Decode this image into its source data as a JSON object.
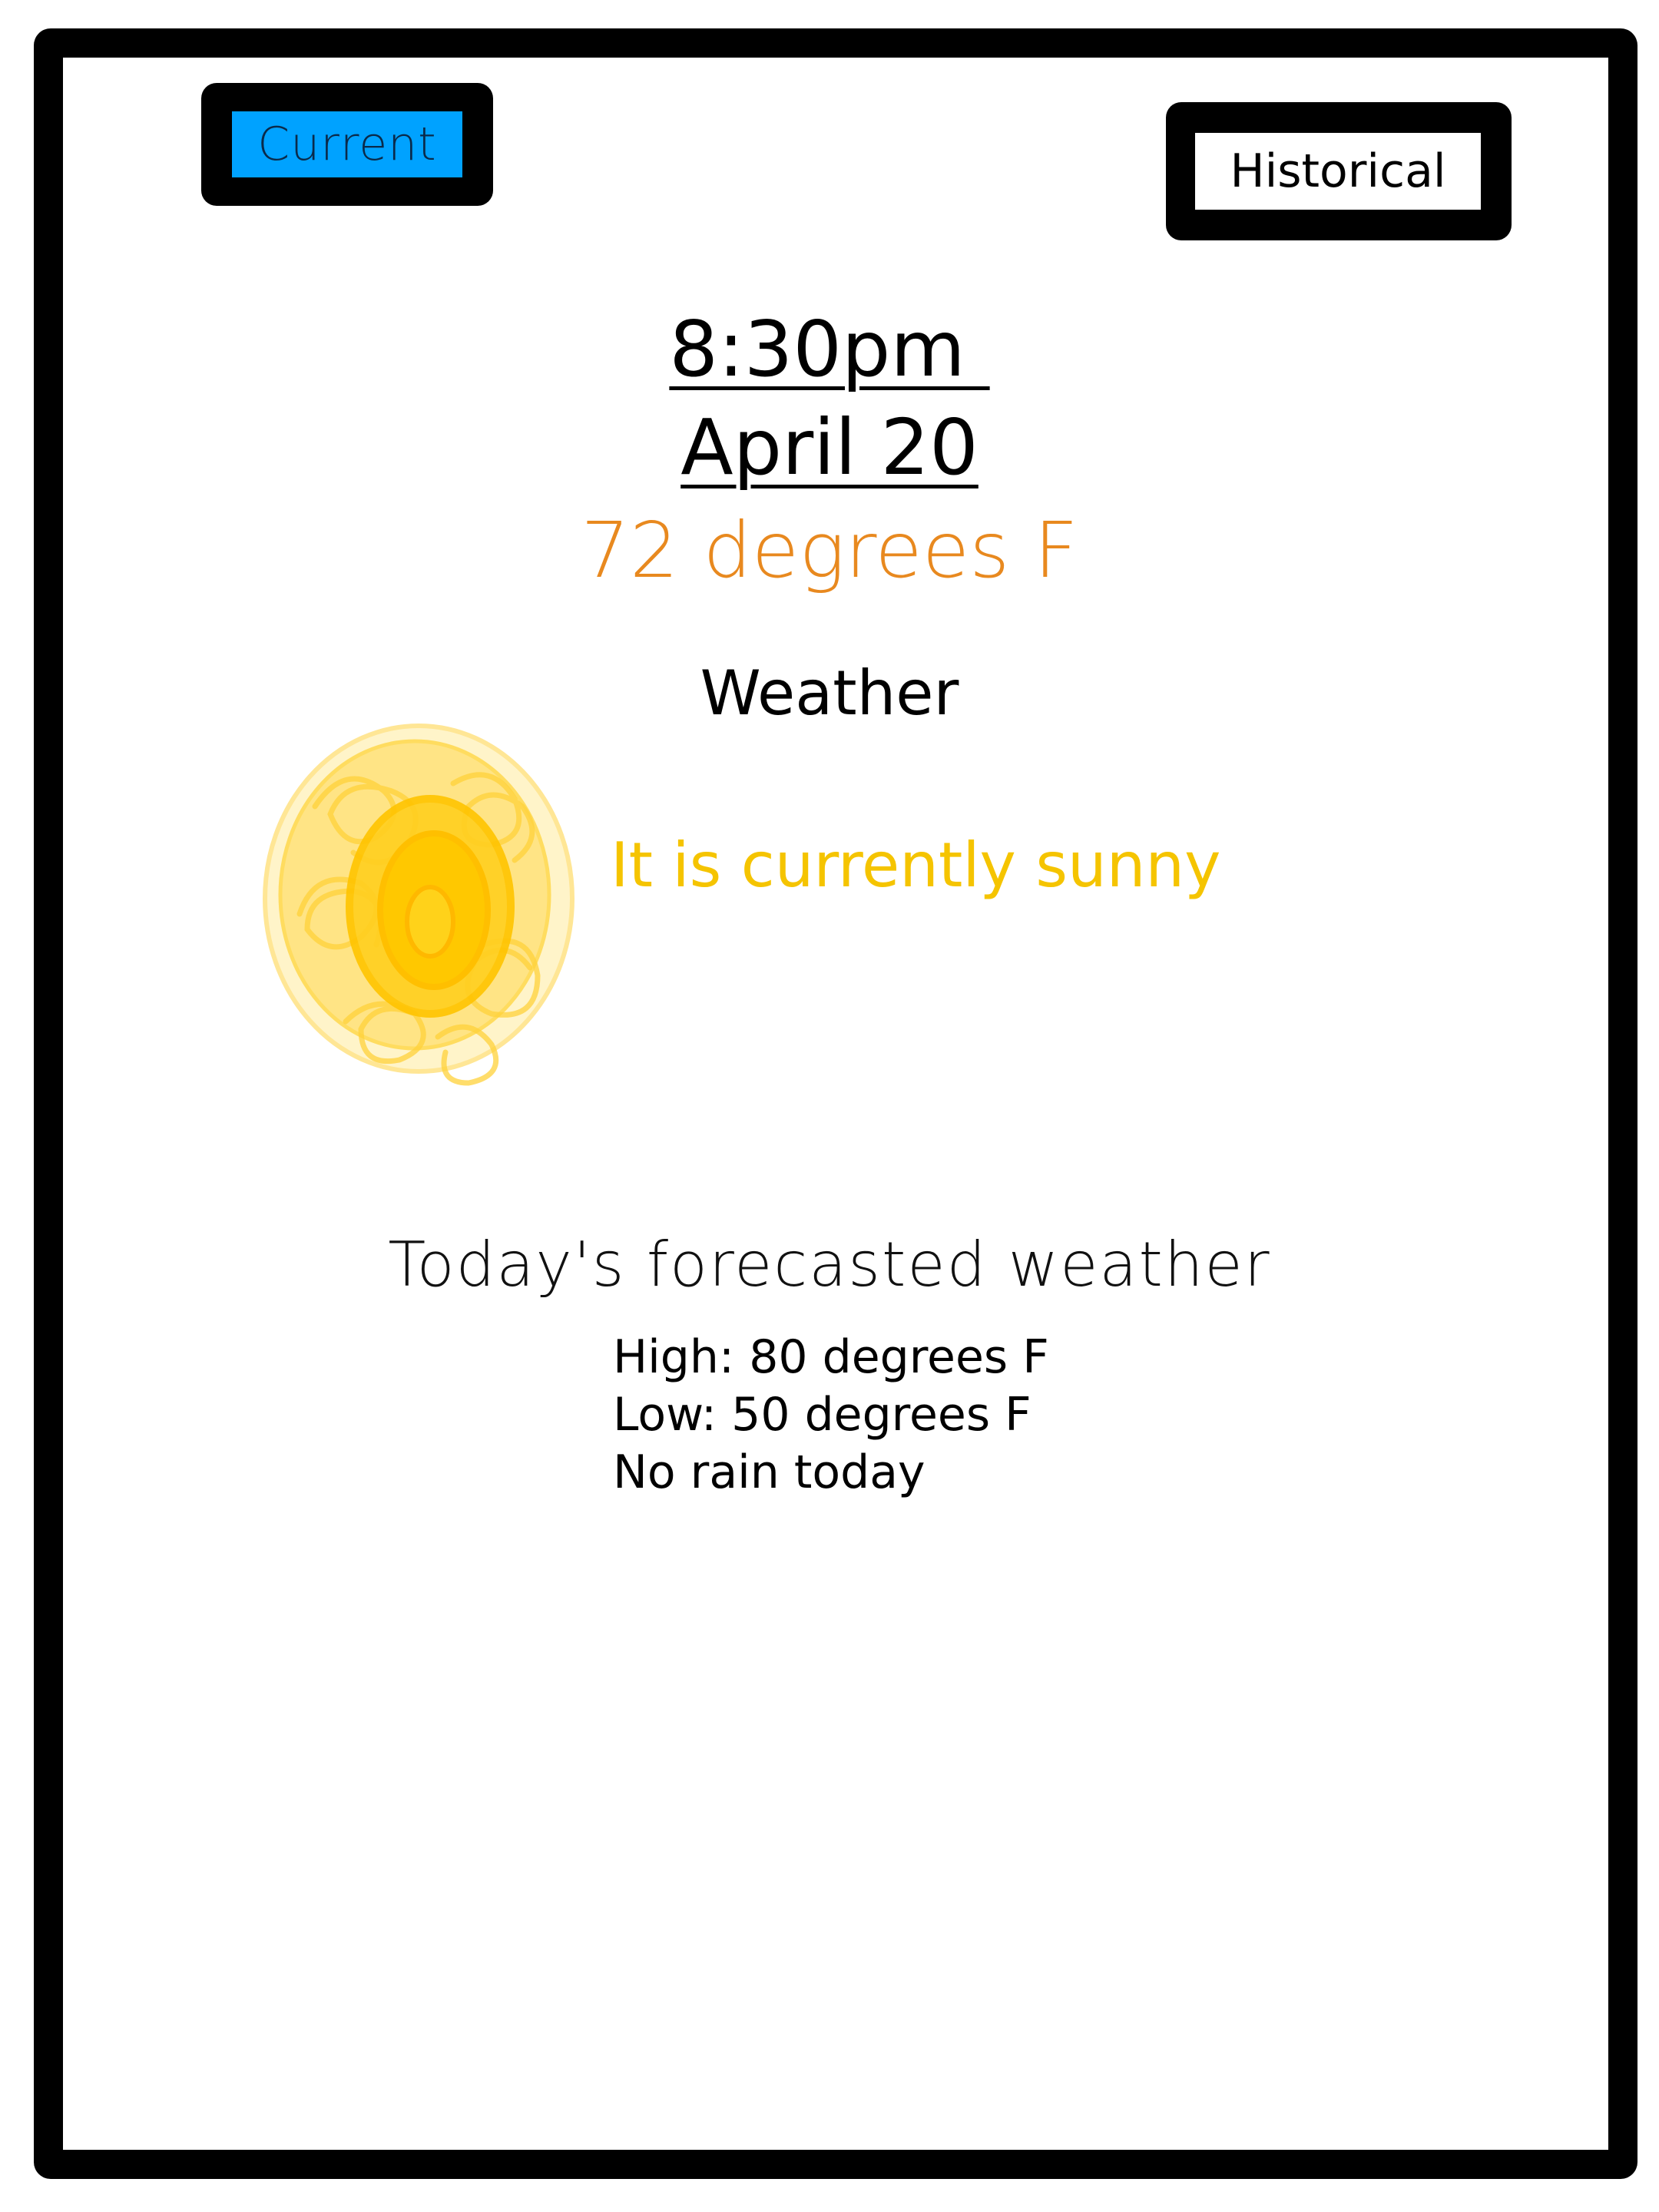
{
  "tabs": {
    "current_label": "Current",
    "historical_label": "Historical"
  },
  "now": {
    "time": "8:30pm ",
    "date": "April 20",
    "temperature": "72 degrees F"
  },
  "weather": {
    "heading": "Weather",
    "condition_text": "It is currently sunny",
    "condition_icon": "sun-icon"
  },
  "forecast": {
    "heading": "Today's forecasted weather",
    "high": "High: 80 degrees F",
    "low": "Low: 50 degrees F",
    "rain": "No rain today"
  },
  "colors": {
    "active_tab": "#00a2ff",
    "temperature": "#e8891f",
    "sunny": "#f5c400"
  }
}
